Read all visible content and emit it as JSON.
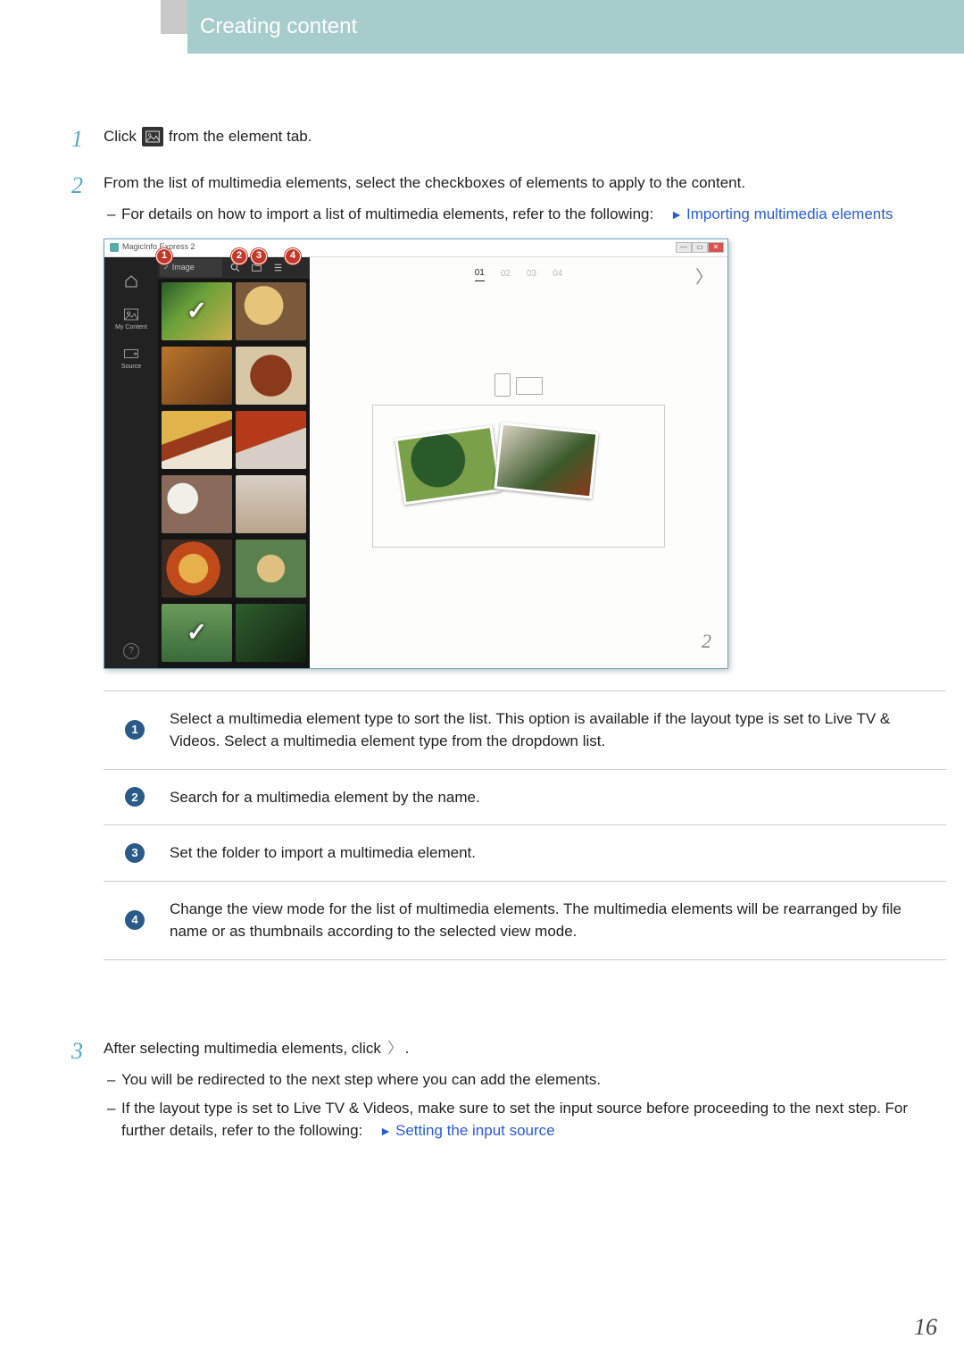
{
  "header": {
    "title": "Creating content"
  },
  "page_number": "16",
  "steps": {
    "s1": {
      "pre": "Click",
      "post": "from the element tab."
    },
    "s2": {
      "text": "From the list of multimedia elements, select the checkboxes of elements to apply to the content.",
      "sub1_pre": "For details on how to import a list of multimedia elements, refer to the following:",
      "sub1_link": "Importing multimedia elements"
    },
    "s3": {
      "pre": "After selecting multimedia elements, click",
      "post": ".",
      "sub1": "You will be redirected to the next step where you can add the elements.",
      "sub2_pre": "If the layout type is set to Live TV & Videos, make sure to set the input source before proceeding to the next step. For further details, refer to the following:",
      "sub2_link": "Setting the input source"
    }
  },
  "figure": {
    "app_title": "MagicInfo Express 2",
    "dropdown_label": "Image",
    "side": {
      "home": "",
      "mycontent": "My Content",
      "source": "Source"
    },
    "pages": {
      "p1": "01",
      "p2": "02",
      "p3": "03",
      "p4": "04"
    },
    "canvas_page": "2",
    "callouts": {
      "c1": "1",
      "c2": "2",
      "c3": "3",
      "c4": "4"
    }
  },
  "table": {
    "r1": {
      "n": "1",
      "text": "Select a multimedia element type to sort the list. This option is available if the layout type is set to Live TV & Videos. Select a multimedia element type from the dropdown list."
    },
    "r2": {
      "n": "2",
      "text": "Search for a multimedia element by the name."
    },
    "r3": {
      "n": "3",
      "text": "Set the folder to import a multimedia element."
    },
    "r4": {
      "n": "4",
      "text": "Change the view mode for the list of multimedia elements. The multimedia elements will be rearranged by file name or as thumbnails according to the selected view mode."
    }
  }
}
